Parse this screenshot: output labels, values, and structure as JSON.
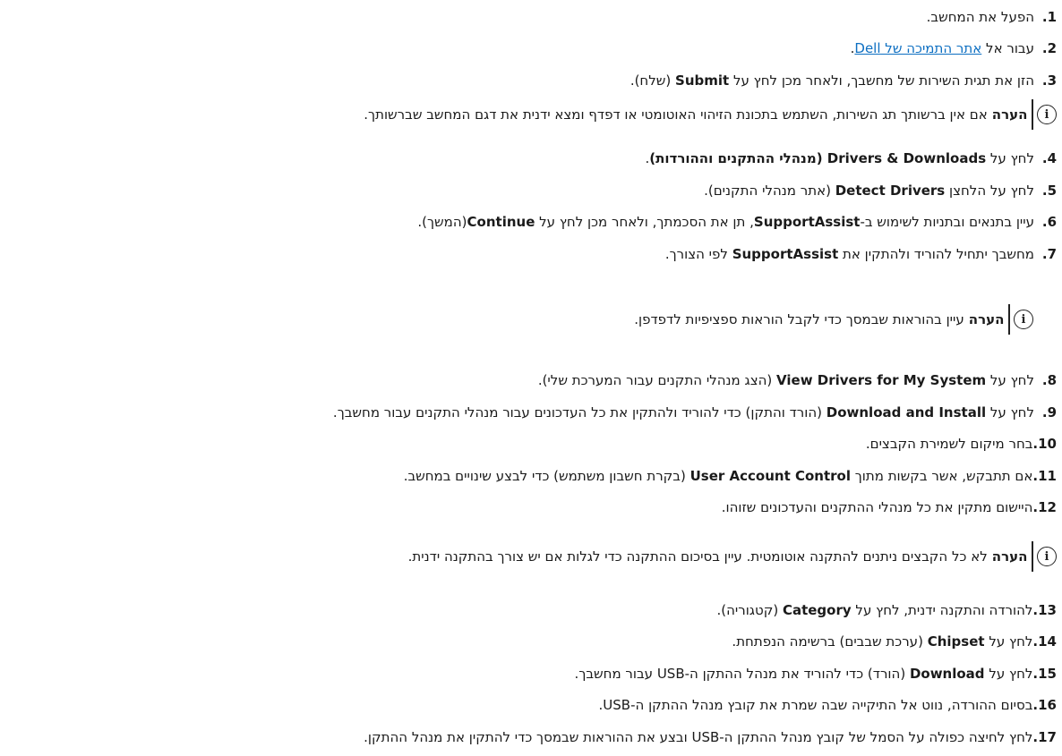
{
  "steps": [
    {
      "num": "1.",
      "parts": [
        {
          "t": "הפעל את המחשב."
        }
      ]
    },
    {
      "num": "2.",
      "parts": [
        {
          "t": "עבור אל "
        },
        {
          "t": "אתר התמיכה של Dell",
          "link": true
        },
        {
          "t": "."
        }
      ]
    },
    {
      "num": "3.",
      "parts": [
        {
          "t": "הזן את תגית השירות של מחשבך, ולאחר מכן לחץ על "
        },
        {
          "t": "Submit",
          "b": true
        },
        {
          "t": " (שלח)."
        }
      ]
    },
    {
      "num": "4.",
      "parts": [
        {
          "t": "לחץ על "
        },
        {
          "t": "Drivers & Downloads (מנהלי ההתקנים וההורדות)",
          "b": true
        },
        {
          "t": "."
        }
      ]
    },
    {
      "num": "5.",
      "parts": [
        {
          "t": "לחץ על הלחצן "
        },
        {
          "t": "Detect Drivers",
          "b": true
        },
        {
          "t": " (אתר מנהלי התקנים)."
        }
      ]
    },
    {
      "num": "6.",
      "parts": [
        {
          "t": "עיין בתנאים ובתניות לשימוש ב-"
        },
        {
          "t": "SupportAssist",
          "b": true
        },
        {
          "t": ", תן את הסכמתך, ולאחר מכן לחץ על "
        },
        {
          "t": "Continue",
          "b": true
        },
        {
          "t": "(המשך)."
        }
      ]
    },
    {
      "num": "7.",
      "parts": [
        {
          "t": "מחשבך יתחיל להוריד ולהתקין את "
        },
        {
          "t": "SupportAssist",
          "b": true
        },
        {
          "t": " לפי הצורך."
        }
      ]
    },
    {
      "num": "8.",
      "parts": [
        {
          "t": "לחץ על "
        },
        {
          "t": "View Drivers for My System",
          "b": true
        },
        {
          "t": " (הצג מנהלי התקנים עבור המערכת שלי)."
        }
      ]
    },
    {
      "num": "9.",
      "parts": [
        {
          "t": "לחץ על "
        },
        {
          "t": "Download and Install",
          "b": true
        },
        {
          "t": " (הורד והתקן) כדי להוריד ולהתקין את כל העדכונים עבור מנהלי התקנים עבור מחשבך."
        }
      ]
    },
    {
      "num": "10.",
      "parts": [
        {
          "t": "בחר מיקום לשמירת הקבצים."
        }
      ]
    },
    {
      "num": "11.",
      "parts": [
        {
          "t": "אם תתבקש, אשר בקשות מתוך "
        },
        {
          "t": "User Account Control",
          "b": true
        },
        {
          "t": " (בקרת חשבון משתמש) כדי לבצע שינויים במחשב."
        }
      ]
    },
    {
      "num": "12.",
      "parts": [
        {
          "t": "היישום מתקין את כל מנהלי ההתקנים והעדכונים שזוהו."
        }
      ]
    },
    {
      "num": "13.",
      "parts": [
        {
          "t": "להורדה והתקנה ידנית, לחץ על "
        },
        {
          "t": "Category",
          "b": true
        },
        {
          "t": " (קטגוריה)."
        }
      ]
    },
    {
      "num": "14.",
      "parts": [
        {
          "t": "לחץ על "
        },
        {
          "t": "Chipset",
          "b": true
        },
        {
          "t": " (ערכת שבבים) ברשימה הנפתחת."
        }
      ]
    },
    {
      "num": "15.",
      "parts": [
        {
          "t": "לחץ על "
        },
        {
          "t": "Download",
          "b": true
        },
        {
          "t": " (הורד) כדי להוריד את מנהל ההתקן ה-USB עבור מחשבך."
        }
      ]
    },
    {
      "num": "16.",
      "parts": [
        {
          "t": "בסיום ההורדה, נווט אל התיקייה שבה שמרת את קובץ מנהל ההתקן ה-USB."
        }
      ]
    },
    {
      "num": "17.",
      "parts": [
        {
          "t": "לחץ לחיצה כפולה על הסמל של קובץ מנהל ההתקן ה-USB ובצע את ההוראות שבמסך כדי להתקין את מנהל ההתקן."
        }
      ]
    }
  ],
  "notes": [
    {
      "icon_glyph": "i",
      "label": "הערה",
      "text": "אם אין ברשותך תג השירות, השתמש בתכונת הזיהוי האוטומטי או דפדף ומצא ידנית את דגם המחשב שברשותך."
    },
    {
      "icon_glyph": "i",
      "label": "הערה",
      "text": "עיין בהוראות שבמסך כדי לקבל הוראות ספציפיות לדפדפן."
    },
    {
      "icon_glyph": "i",
      "label": "הערה",
      "text": "לא כל הקבצים ניתנים להתקנה אוטומטית. עיין בסיכום ההתקנה כדי לגלות אם יש צורך בהתקנה ידנית."
    }
  ],
  "colors": {
    "link": "#0d6fc2",
    "text": "#1a1a1a"
  }
}
